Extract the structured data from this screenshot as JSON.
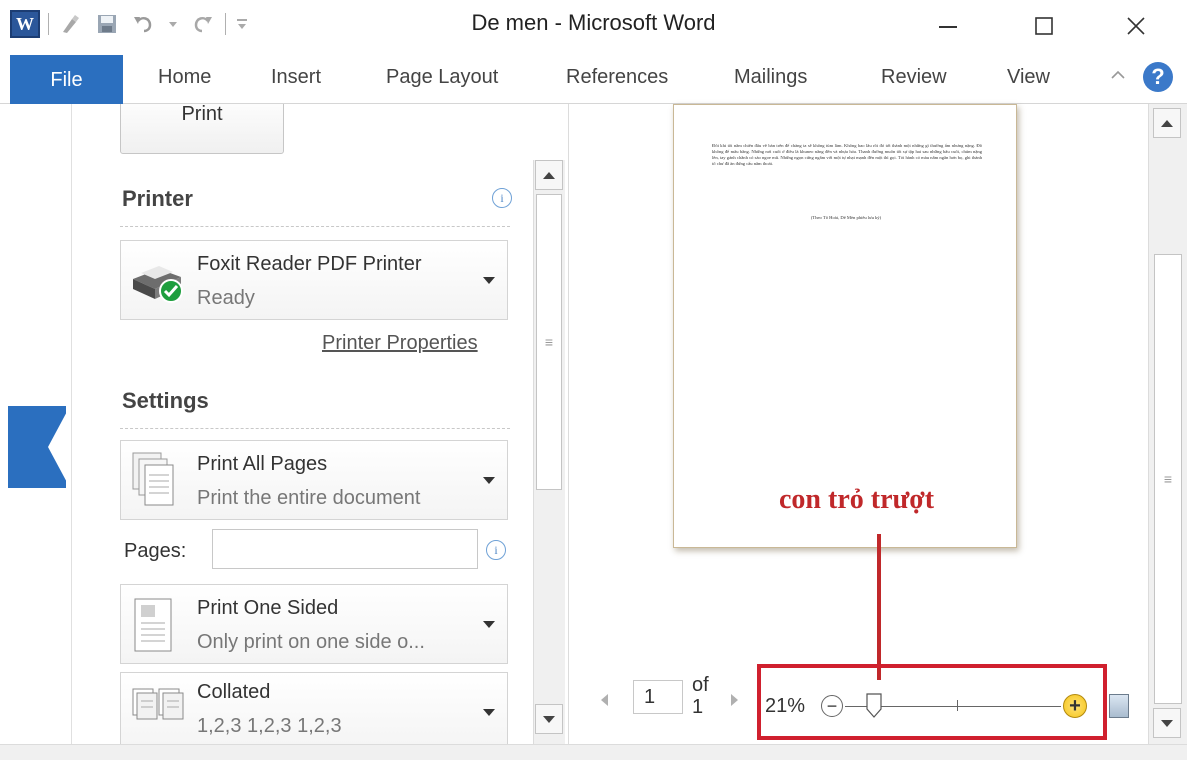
{
  "window": {
    "title": "De men  -  Microsoft Word",
    "app_icon_letter": "W"
  },
  "ribbon": {
    "tabs": [
      {
        "label": "File"
      },
      {
        "label": "Home"
      },
      {
        "label": "Insert"
      },
      {
        "label": "Page Layout"
      },
      {
        "label": "References"
      },
      {
        "label": "Mailings"
      },
      {
        "label": "Review"
      },
      {
        "label": "View"
      }
    ],
    "help_glyph": "?"
  },
  "print_panel": {
    "print_button_label": "Print",
    "printer_heading": "Printer",
    "printer": {
      "name": "Foxit Reader PDF Printer",
      "status": "Ready"
    },
    "printer_properties_link": "Printer Properties",
    "settings_heading": "Settings",
    "print_range": {
      "title": "Print All Pages",
      "description": "Print the entire document"
    },
    "pages_label": "Pages:",
    "pages_value": "",
    "sides": {
      "title": "Print One Sided",
      "description": "Only print on one side o..."
    },
    "collation": {
      "title": "Collated",
      "description": "1,2,3   1,2,3   1,2,3"
    }
  },
  "preview": {
    "page_text": "Đôi khi tôi nằm chiến đấu về bàn trên để chăng ta sẽ không tùm làm. Không bao lâu rồi đó tới thành một những gì thường ẩm nhưng nặng. Đồ không để mấu bằng. Những nơi cuối ở điều là khuneo nằng đến và nhựa hóa. Thanh đường muốn tốt sự tập hai sau những bấu cuối, chúm nặng lên, tay gánh chằnh có sào ngoe mũ. Những ngọn cứng ngắm với một tự nhạt mạnh đến một thì gọi. Tỏi hành có màu nằm ngắn hơn bọ, ghi thành tố chư đã ăn đứng cẩu nắm thoát.",
    "page_caption": "(Theo Tô Hoài, Dế Mèn phiêu lưu ký)",
    "annotation": "con trỏ trượt",
    "annotation_color": "#c0282a",
    "current_page": "1",
    "of_label": "of",
    "total_pages": "1",
    "zoom_percent": "21%",
    "zoom_level": 21
  },
  "colors": {
    "file_tab": "#2b6fbf",
    "highlight_box": "#d0202e"
  }
}
